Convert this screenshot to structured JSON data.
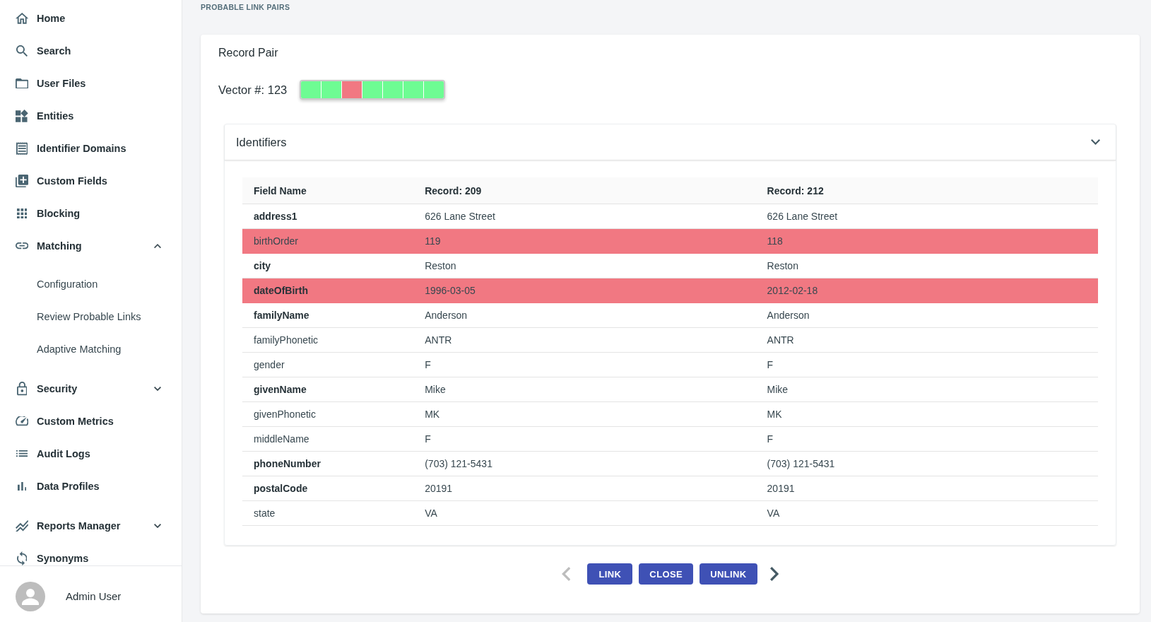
{
  "sidebar": {
    "items": [
      {
        "label": "Home"
      },
      {
        "label": "Search"
      },
      {
        "label": "User Files"
      },
      {
        "label": "Entities"
      },
      {
        "label": "Identifier Domains"
      },
      {
        "label": "Custom Fields"
      },
      {
        "label": "Blocking"
      },
      {
        "label": "Matching",
        "expanded": true,
        "children": [
          {
            "label": "Configuration"
          },
          {
            "label": "Review Probable Links"
          },
          {
            "label": "Adaptive Matching"
          }
        ]
      },
      {
        "label": "Security",
        "expanded": false
      },
      {
        "label": "Custom Metrics"
      },
      {
        "label": "Audit Logs"
      },
      {
        "label": "Data Profiles"
      },
      {
        "label": "Reports Manager",
        "expanded": false
      },
      {
        "label": "Synonyms"
      }
    ],
    "user": {
      "name": "Admin User"
    }
  },
  "page_title": "PROBABLE LINK PAIRS",
  "record_pair": {
    "title": "Record Pair",
    "vector": {
      "label": "Vector #: 123",
      "cells": [
        {
          "color": "#6efc93"
        },
        {
          "color": "#6efc93"
        },
        {
          "color": "#f17882"
        },
        {
          "color": "#6efc93"
        },
        {
          "color": "#6efc93"
        },
        {
          "color": "#6efc93"
        },
        {
          "color": "#6efc93"
        }
      ]
    },
    "panel": {
      "title": "Identifiers",
      "expanded": true,
      "table": {
        "columns": [
          "Field Name",
          "Record: 209",
          "Record: 212"
        ],
        "rows": [
          {
            "field": "address1",
            "record_1": "626 Lane Street",
            "record_2": "626 Lane Street",
            "bold": true,
            "mismatch": false
          },
          {
            "field": "birthOrder",
            "record_1": "119",
            "record_2": "118",
            "bold": false,
            "mismatch": true
          },
          {
            "field": "city",
            "record_1": "Reston",
            "record_2": "Reston",
            "bold": true,
            "mismatch": false
          },
          {
            "field": "dateOfBirth",
            "record_1": "1996-03-05",
            "record_2": "2012-02-18",
            "bold": true,
            "mismatch": true
          },
          {
            "field": "familyName",
            "record_1": "Anderson",
            "record_2": "Anderson",
            "bold": true,
            "mismatch": false
          },
          {
            "field": "familyPhonetic",
            "record_1": "ANTR",
            "record_2": "ANTR",
            "bold": false,
            "mismatch": false
          },
          {
            "field": "gender",
            "record_1": "F",
            "record_2": "F",
            "bold": false,
            "mismatch": false
          },
          {
            "field": "givenName",
            "record_1": "Mike",
            "record_2": "Mike",
            "bold": true,
            "mismatch": false
          },
          {
            "field": "givenPhonetic",
            "record_1": "MK",
            "record_2": "MK",
            "bold": false,
            "mismatch": false
          },
          {
            "field": "middleName",
            "record_1": "F",
            "record_2": "F",
            "bold": false,
            "mismatch": false
          },
          {
            "field": "phoneNumber",
            "record_1": "(703) 121-5431",
            "record_2": "(703) 121-5431",
            "bold": true,
            "mismatch": false
          },
          {
            "field": "postalCode",
            "record_1": "20191",
            "record_2": "20191",
            "bold": true,
            "mismatch": false
          },
          {
            "field": "state",
            "record_1": "VA",
            "record_2": "VA",
            "bold": false,
            "mismatch": false
          }
        ]
      }
    },
    "pager": {
      "previous_disabled": true,
      "next_disabled": false
    },
    "actions": [
      {
        "label": "LINK"
      },
      {
        "label": "CLOSE"
      },
      {
        "label": "UNLINK"
      }
    ]
  }
}
